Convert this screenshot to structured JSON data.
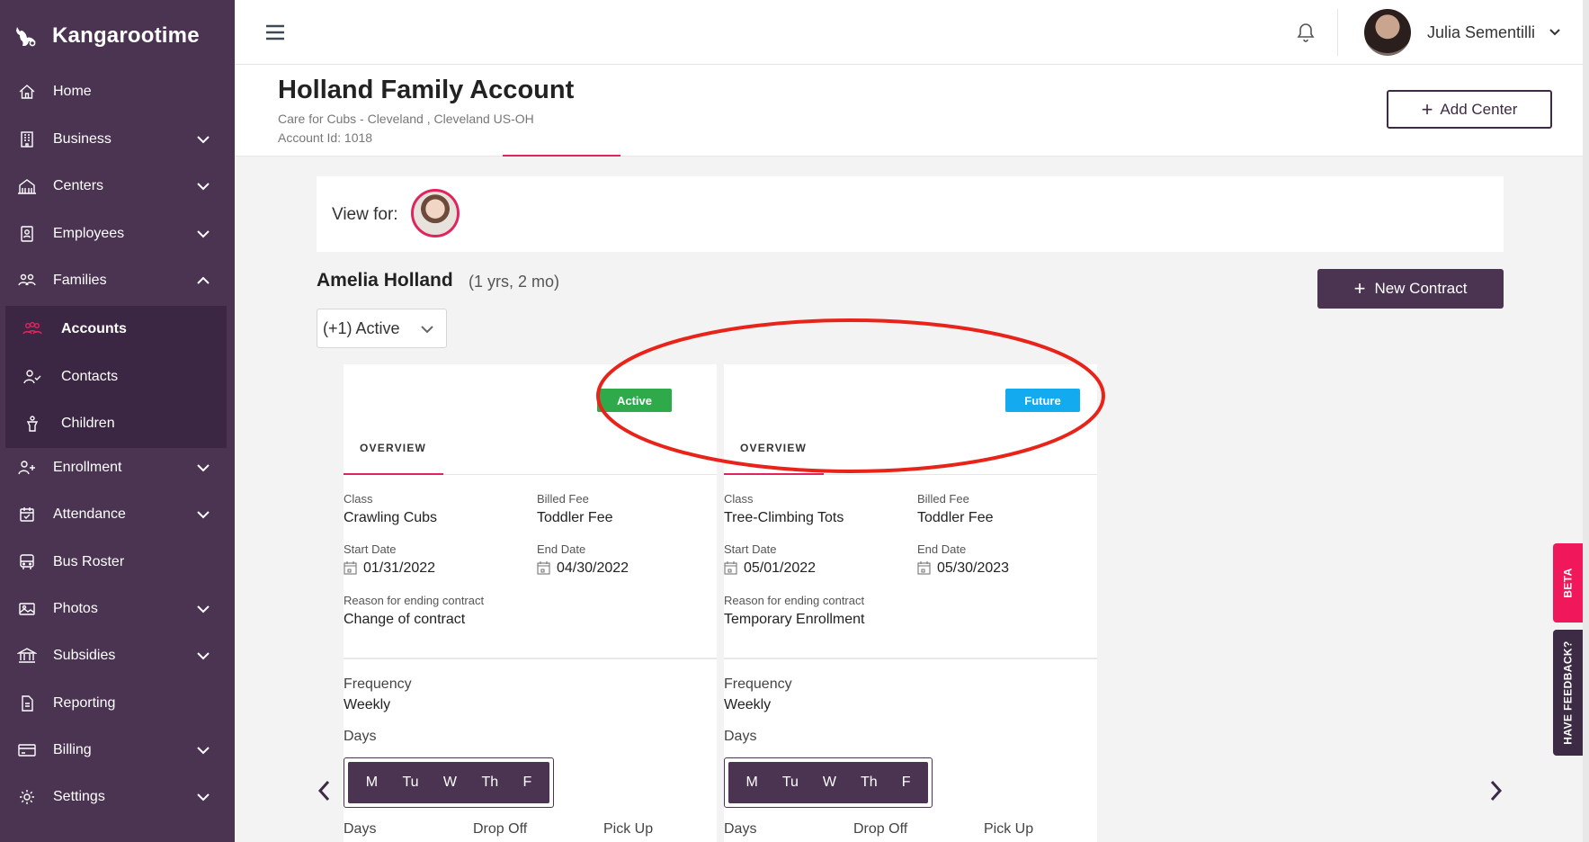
{
  "brand": {
    "name": "Kangarootime"
  },
  "sidebar": {
    "items": [
      {
        "label": "Home",
        "icon": "home-icon"
      },
      {
        "label": "Business",
        "icon": "building-icon"
      },
      {
        "label": "Centers",
        "icon": "centers-icon"
      },
      {
        "label": "Employees",
        "icon": "badge-icon"
      },
      {
        "label": "Families",
        "icon": "people-icon"
      },
      {
        "label": "Enrollment",
        "icon": "add-user-icon"
      },
      {
        "label": "Attendance",
        "icon": "calendar-check-icon"
      },
      {
        "label": "Bus Roster",
        "icon": "bus-icon"
      },
      {
        "label": "Photos",
        "icon": "image-icon"
      },
      {
        "label": "Subsidies",
        "icon": "bank-icon"
      },
      {
        "label": "Reporting",
        "icon": "report-icon"
      },
      {
        "label": "Billing",
        "icon": "card-icon"
      },
      {
        "label": "Settings",
        "icon": "gear-icon"
      }
    ],
    "families_sub": [
      {
        "label": "Accounts",
        "icon": "group-icon"
      },
      {
        "label": "Contacts",
        "icon": "contact-icon"
      },
      {
        "label": "Children",
        "icon": "child-icon"
      }
    ]
  },
  "header": {
    "user_name": "Julia Sementilli"
  },
  "account": {
    "title": "Holland Family Account",
    "center": "Care for Cubs - Cleveland , Cleveland US-OH",
    "account_id": "Account Id: 1018",
    "add_center_label": "Add Center"
  },
  "view_for": {
    "label": "View for:"
  },
  "child": {
    "name": "Amelia Holland",
    "age": "(1 yrs, 2 mo)"
  },
  "new_contract_label": "New Contract",
  "status_filter": "(+1) Active",
  "contracts": [
    {
      "status": "Active",
      "status_color": "#2eaa4a",
      "tab": "OVERVIEW",
      "class_label": "Class",
      "class_value": "Crawling Cubs",
      "fee_label": "Billed Fee",
      "fee_value": "Toddler Fee",
      "start_label": "Start Date",
      "start_value": "01/31/2022",
      "end_label": "End Date",
      "end_value": "04/30/2022",
      "reason_label": "Reason for ending contract",
      "reason_value": "Change of contract",
      "frequency_label": "Frequency",
      "frequency_value": "Weekly",
      "days_label": "Days",
      "days": [
        "M",
        "Tu",
        "W",
        "Th",
        "F"
      ],
      "cols": [
        "Days",
        "Drop Off",
        "Pick Up"
      ]
    },
    {
      "status": "Future",
      "status_color": "#14aaf0",
      "tab": "OVERVIEW",
      "class_label": "Class",
      "class_value": "Tree-Climbing Tots",
      "fee_label": "Billed Fee",
      "fee_value": "Toddler Fee",
      "start_label": "Start Date",
      "start_value": "05/01/2022",
      "end_label": "End Date",
      "end_value": "05/30/2023",
      "reason_label": "Reason for ending contract",
      "reason_value": "Temporary Enrollment",
      "frequency_label": "Frequency",
      "frequency_value": "Weekly",
      "days_label": "Days",
      "days": [
        "M",
        "Tu",
        "W",
        "Th",
        "F"
      ],
      "cols": [
        "Days",
        "Drop Off",
        "Pick Up"
      ]
    }
  ],
  "side_tabs": {
    "beta": "BETA",
    "feedback": "HAVE FEEDBACK?"
  },
  "colors": {
    "sidebar": "#4b3352",
    "accent": "#e0245e",
    "annotation": "#e8241a"
  }
}
